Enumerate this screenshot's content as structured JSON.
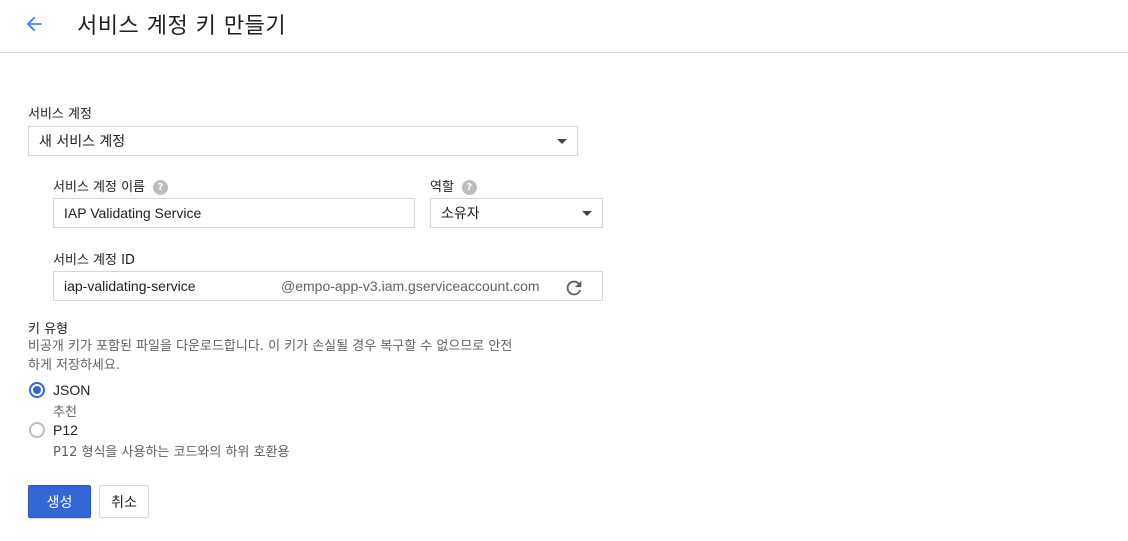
{
  "header": {
    "title": "서비스 계정 키 만들기",
    "back_icon": "arrow-left-icon",
    "accent": "#4285f4"
  },
  "service_account": {
    "label": "서비스 계정",
    "selected": "새 서비스 계정"
  },
  "account_name": {
    "label": "서비스 계정 이름",
    "value": "IAP Validating Service",
    "help_icon": "help-icon"
  },
  "role": {
    "label": "역할",
    "selected": "소유자",
    "help_icon": "help-icon"
  },
  "account_id": {
    "label": "서비스 계정 ID",
    "value": "iap-validating-service",
    "suffix": "@empo-app-v3.iam.gserviceaccount.com",
    "refresh_icon": "refresh-icon"
  },
  "key_type": {
    "title": "키 유형",
    "description_line1": "비공개 키가 포함된 파일을 다운로드합니다. 이 키가 손실될 경우 복구할 수 없으므로 안전",
    "description_line2": "하게 저장하세요.",
    "options": [
      {
        "label": "JSON",
        "sub": "추천",
        "checked": true
      },
      {
        "label": "P12",
        "sub": "P12 형식을 사용하는 코드와의 하위 호환용",
        "checked": false
      }
    ]
  },
  "actions": {
    "create": "생성",
    "cancel": "취소",
    "primary_color": "#3367d6"
  }
}
